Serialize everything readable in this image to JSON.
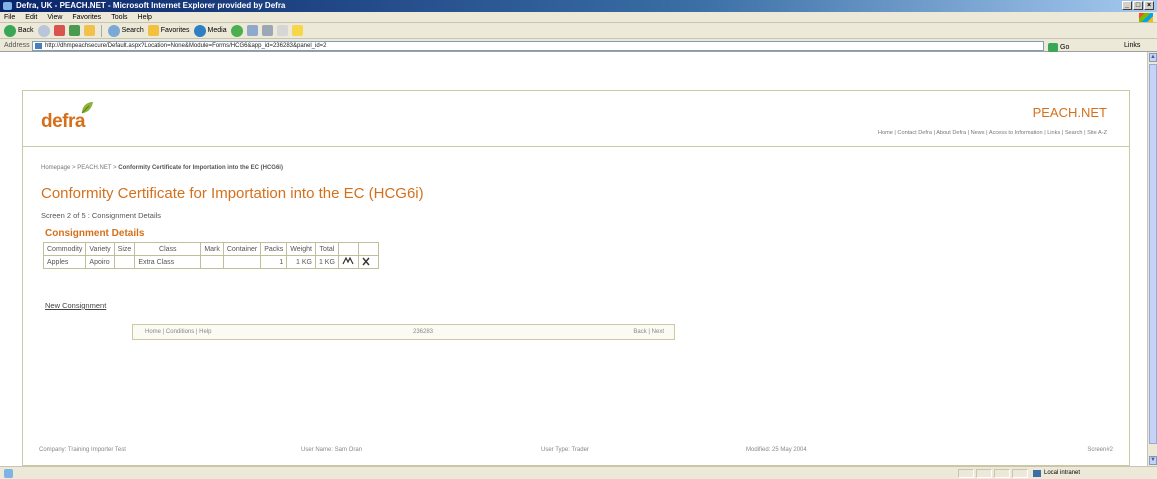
{
  "window": {
    "title": "Defra, UK - PEACH.NET - Microsoft Internet Explorer provided by Defra"
  },
  "menu": [
    "File",
    "Edit",
    "View",
    "Favorites",
    "Tools",
    "Help"
  ],
  "toolbar": {
    "back": "Back",
    "search": "Search",
    "favorites": "Favorites",
    "media": "Media"
  },
  "address": {
    "label": "Address",
    "url": "http://dhmpeachsecure/Default.aspx?Location=None&Module=Forms/HCG6&app_id=236283&panel_id=2",
    "go": "Go",
    "links": "Links"
  },
  "site": {
    "logo": "defra",
    "brand": "PEACH.NET",
    "toplinks": "Home | Contact Defra | About Defra | News | Access to Information | Links | Search | Site A-Z"
  },
  "breadcrumb": {
    "home": "Homepage",
    "peach": "PEACH.NET",
    "current": "Conformity Certificate for Importation into the EC (HCG6i)"
  },
  "page": {
    "title": "Conformity Certificate for Importation into the EC (HCG6i)",
    "step": "Screen 2 of 5 : Consignment Details",
    "section": "Consignment Details"
  },
  "table": {
    "headers": [
      "Commodity",
      "Variety",
      "Size",
      "Class",
      "Mark",
      "Container",
      "Packs",
      "Weight",
      "Total",
      "",
      ""
    ],
    "rows": [
      [
        "Apples",
        "Apoiro",
        "",
        "Extra Class",
        "",
        "",
        "1",
        "1 KG",
        "1 KG",
        "",
        ""
      ]
    ]
  },
  "actions": {
    "new_consignment": "New Consignment",
    "edit_icon": "edit-icon",
    "delete_icon": "delete-icon"
  },
  "footer_nav": {
    "left": "Home | Conditions | Help",
    "middle": "236283",
    "right": "Back | Next"
  },
  "status_row": {
    "company": "Company: Training Importer Test",
    "user_name": "User Name: Sam Oran",
    "user_type": "User Type: Trader",
    "modified": "Modified: 25 May 2004",
    "screen": "Screen#2"
  },
  "statusbar": {
    "zone": "Local intranet"
  },
  "colors": {
    "accent": "#d4701c",
    "border": "#c9c9a3",
    "titlebar": "#0a246a"
  }
}
